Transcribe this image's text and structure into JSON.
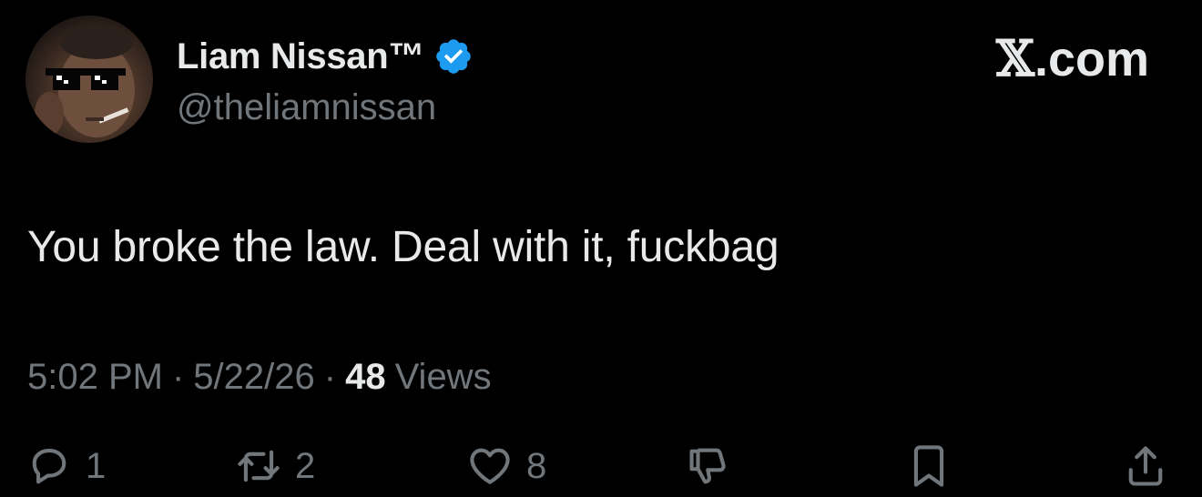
{
  "author": {
    "display_name": "Liam Nissan™",
    "handle": "@theliamnissan",
    "verified": true,
    "verified_color": "#1d9bf0"
  },
  "brand": {
    "x_mark": "𝕏",
    "domain": ".com"
  },
  "tweet": {
    "text": "You broke the law. Deal with it, fuckbag"
  },
  "meta": {
    "time": "5:02 PM",
    "separator": "·",
    "date": "5/22/26",
    "views_count": "48",
    "views_label": "Views"
  },
  "actions": {
    "reply": {
      "icon": "reply-icon",
      "count": "1"
    },
    "retweet": {
      "icon": "retweet-icon",
      "count": "2"
    },
    "like": {
      "icon": "heart-icon",
      "count": "8"
    },
    "dislike": {
      "icon": "thumbs-down-icon"
    },
    "bookmark": {
      "icon": "bookmark-icon"
    },
    "share": {
      "icon": "share-icon"
    }
  },
  "colors": {
    "background": "#000000",
    "primary_text": "#e7e9ea",
    "secondary_text": "#71767b"
  }
}
